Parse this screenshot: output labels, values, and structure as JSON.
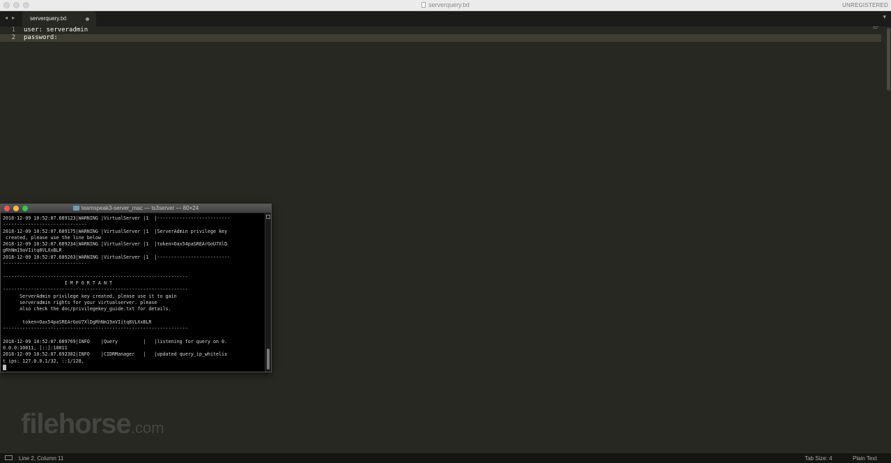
{
  "window": {
    "title": "serverquery.txt",
    "registration": "UNREGISTERED"
  },
  "tabbar": {
    "nav_arrows": "◂ ▸",
    "active_tab": "serverquery.txt",
    "dropdown": "▾"
  },
  "editor": {
    "line_numbers": [
      "1",
      "2"
    ],
    "lines": [
      "user: serveradmin",
      "password:"
    ]
  },
  "statusbar": {
    "position": "Line 2, Column 11",
    "tab_size": "Tab Size: 4",
    "syntax": "Plain Text"
  },
  "watermark": {
    "brand": "filehorse",
    "suffix": ".com"
  },
  "terminal": {
    "title": "teamspeak3-server_mac — ts3server — 80×24",
    "lines": [
      "2018-12-09 10:52:07.689123|WARNING |VirtualServer |1  |--------------------------",
      "------------------------------",
      "2018-12-09 10:52:07.689175|WARNING |VirtualServer |1  |ServerAdmin privilege key",
      " created, please use the line below",
      "2018-12-09 10:52:07.689234|WARNING |VirtualServer |1  |token=Oax54paSREArGoU7XlD",
      "gRhNm19aVIitq8VLXxBLR",
      "2018-12-09 10:52:07.689263|WARNING |VirtualServer |1  |--------------------------",
      "------------------------------",
      "",
      "------------------------------------------------------------------",
      "                      I M P O R T A N T",
      "------------------------------------------------------------------",
      "      ServerAdmin privilege key created, please use it to gain",
      "      serveradmin rights for your virtualserver. please",
      "      also check the doc/privilegekey_guide.txt for details.",
      "",
      "       token=Oax54paSREArGoU7XlDgRhNm19aVIitq8VLXxBLR",
      "------------------------------------------------------------------",
      "",
      "2018-12-09 10:52:07.689769|INFO    |Query         |   |listening for query on 0.",
      "0.0.0:10011, [::]:10011",
      "2018-12-09 10:52:07.692382|INFO    |CIDRManager   |   |updated query_ip_whitelis",
      "t ips: 127.0.0.1/32, ::1/128,"
    ]
  }
}
